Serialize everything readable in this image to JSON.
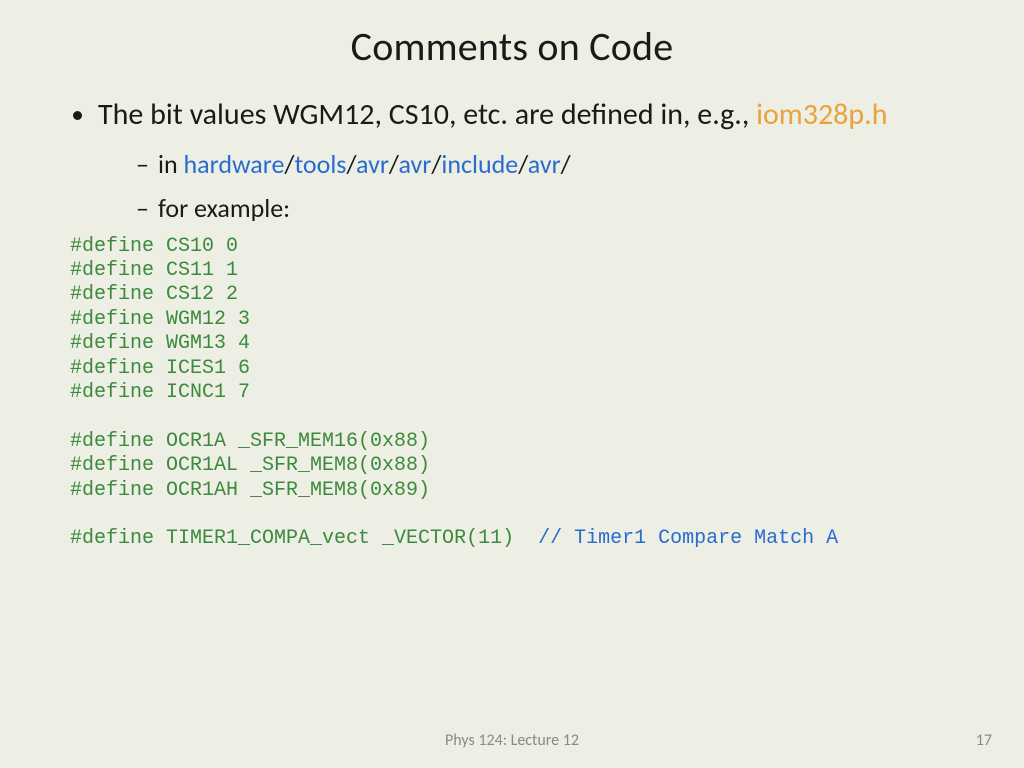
{
  "title": "Comments on Code",
  "bullet1_pre": "The bit values WGM12, CS10, etc. are defined in, e.g., ",
  "bullet1_orange": "iom328p.h",
  "sub1_pre": "in ",
  "path": [
    "hardware",
    "tools",
    "avr",
    "avr",
    "include",
    "avr"
  ],
  "sub2": "for example:",
  "code_lines": [
    "#define CS10 0",
    "#define CS11 1",
    "#define CS12 2",
    "#define WGM12 3",
    "#define WGM13 4",
    "#define ICES1 6",
    "#define ICNC1 7",
    "",
    "#define OCR1A _SFR_MEM16(0x88)",
    "#define OCR1AL _SFR_MEM8(0x88)",
    "#define OCR1AH _SFR_MEM8(0x89)",
    ""
  ],
  "code_last_def": "#define TIMER1_COMPA_vect _VECTOR(11)  ",
  "code_last_comment": "// Timer1 Compare Match A",
  "footer_center": "Phys 124: Lecture 12",
  "footer_right": "17"
}
